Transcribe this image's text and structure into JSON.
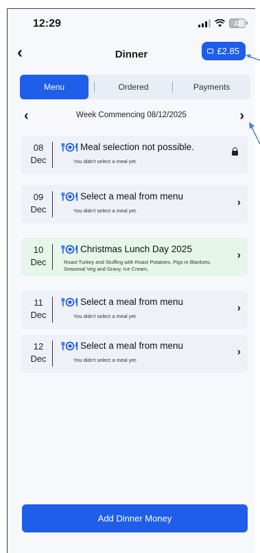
{
  "status": {
    "time": "12:29",
    "battery": "22"
  },
  "nav": {
    "title": "Dinner",
    "back_icon": "chevron-left-icon",
    "balance": "£2.85"
  },
  "tabs": [
    {
      "label": "Menu",
      "active": true
    },
    {
      "label": "Ordered",
      "active": false
    },
    {
      "label": "Payments",
      "active": false
    }
  ],
  "week": {
    "label": "Week Commencing  08/12/2025"
  },
  "days": [
    {
      "day": "08",
      "month": "Dec",
      "title": "Meal selection not possible.",
      "subtitle": "You didn't select a meal yet.",
      "locked": true
    },
    {
      "day": "09",
      "month": "Dec",
      "title": "Select a meal from menu",
      "subtitle": "You didn't select a meal yet."
    },
    {
      "day": "10",
      "month": "Dec",
      "title": "Christmas Lunch Day 2025",
      "subtitle": "Roast Turkey and Stuffing with Roast Potatoes, Pigs in Blankets, Seasonal Veg and Gravy, Ice Cream,",
      "highlight": true
    },
    {
      "day": "11",
      "month": "Dec",
      "title": "Select a meal from menu",
      "subtitle": "You didn't select a meal yet."
    },
    {
      "day": "12",
      "month": "Dec",
      "title": "Select a meal from menu",
      "subtitle": "You didn't select a meal yet."
    }
  ],
  "footer": {
    "add_button": "Add Dinner Money"
  },
  "colors": {
    "accent": "#1e5ee8",
    "card": "#eef1f7",
    "highlight": "#e6f6ea",
    "annotation": "#4a7fd4"
  }
}
